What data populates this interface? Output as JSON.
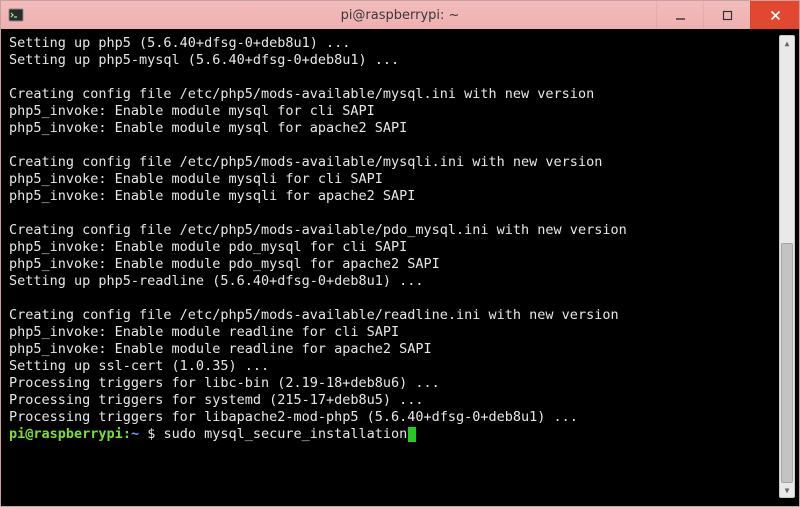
{
  "window": {
    "title": "pi@raspberrypi: ~"
  },
  "terminal": {
    "lines": [
      "Setting up php5 (5.6.40+dfsg-0+deb8u1) ...",
      "Setting up php5-mysql (5.6.40+dfsg-0+deb8u1) ...",
      "",
      "Creating config file /etc/php5/mods-available/mysql.ini with new version",
      "php5_invoke: Enable module mysql for cli SAPI",
      "php5_invoke: Enable module mysql for apache2 SAPI",
      "",
      "Creating config file /etc/php5/mods-available/mysqli.ini with new version",
      "php5_invoke: Enable module mysqli for cli SAPI",
      "php5_invoke: Enable module mysqli for apache2 SAPI",
      "",
      "Creating config file /etc/php5/mods-available/pdo_mysql.ini with new version",
      "php5_invoke: Enable module pdo_mysql for cli SAPI",
      "php5_invoke: Enable module pdo_mysql for apache2 SAPI",
      "Setting up php5-readline (5.6.40+dfsg-0+deb8u1) ...",
      "",
      "Creating config file /etc/php5/mods-available/readline.ini with new version",
      "php5_invoke: Enable module readline for cli SAPI",
      "php5_invoke: Enable module readline for apache2 SAPI",
      "Setting up ssl-cert (1.0.35) ...",
      "Processing triggers for libc-bin (2.19-18+deb8u6) ...",
      "Processing triggers for systemd (215-17+deb8u5) ...",
      "Processing triggers for libapache2-mod-php5 (5.6.40+dfsg-0+deb8u1) ..."
    ],
    "prompt": {
      "user": "pi",
      "host": "raspberrypi",
      "path": "~",
      "symbol": "$",
      "command": "sudo mysql_secure_installation"
    }
  }
}
